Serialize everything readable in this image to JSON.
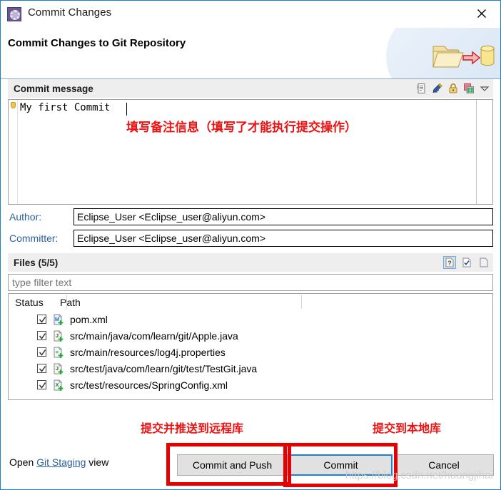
{
  "window": {
    "title": "Commit Changes",
    "icon": "commit-changes-icon",
    "close_label": "✕"
  },
  "banner": {
    "title": "Commit Changes to Git Repository",
    "art": "folder-to-repository-icon"
  },
  "commit_message": {
    "section_label": "Commit message",
    "value": "My first Commit",
    "tools": [
      {
        "name": "insert-signed-off-by-icon",
        "glyph": "signed-off"
      },
      {
        "name": "insert-change-id-icon",
        "glyph": "change-id"
      },
      {
        "name": "amend-previous-commit-icon",
        "glyph": "lock"
      },
      {
        "name": "add-change-id-icon",
        "glyph": "colorful"
      },
      {
        "name": "chevron-down-icon",
        "glyph": "chevron"
      }
    ]
  },
  "author": {
    "label": "Author:",
    "value": "Eclipse_User <Eclipse_user@aliyun.com>"
  },
  "committer": {
    "label": "Committer:",
    "value": "Eclipse_User <Eclipse_user@aliyun.com>"
  },
  "files": {
    "section_label": "Files (5/5)",
    "filter_placeholder": "type filter text",
    "filter_value": "",
    "tools": [
      {
        "name": "show-untracked-files-icon",
        "glyph": "?",
        "active": true
      },
      {
        "name": "select-all-icon",
        "glyph": "check",
        "active": false
      },
      {
        "name": "deselect-all-icon",
        "glyph": "blank",
        "active": false
      }
    ],
    "columns": [
      "Status",
      "Path"
    ],
    "rows": [
      {
        "checked": true,
        "icon": "maven-xml-file-added-icon",
        "icon_letter": "M",
        "path": "pom.xml"
      },
      {
        "checked": true,
        "icon": "java-file-added-icon",
        "icon_letter": "J",
        "path": "src/main/java/com/learn/git/Apple.java"
      },
      {
        "checked": true,
        "icon": "properties-file-added-icon",
        "icon_letter": "≡",
        "path": "src/main/resources/log4j.properties"
      },
      {
        "checked": true,
        "icon": "java-file-added-icon",
        "icon_letter": "J",
        "path": "src/test/java/com/learn/git/test/TestGit.java"
      },
      {
        "checked": true,
        "icon": "xml-file-added-icon",
        "icon_letter": "X",
        "path": "src/test/resources/SpringConfig.xml"
      }
    ]
  },
  "footer": {
    "open_prefix": "Open ",
    "link_label": "Git Staging",
    "open_suffix": " view",
    "commit_and_push": "Commit and Push",
    "commit": "Commit",
    "cancel": "Cancel"
  },
  "annotations": {
    "message_hint": "填写备注信息（填写了才能执行提交操作）",
    "push_hint": "提交并推送到远程库",
    "local_hint": "提交到本地库"
  },
  "watermark": "https://blog.csdn.net/huangjihai",
  "colors": {
    "dialog_border": "#1b7fd4",
    "accent_blue": "#2a5f9e",
    "annotation_red": "#ee1111",
    "highlight_red": "#e60000",
    "section_bg": "#eeeeee"
  }
}
